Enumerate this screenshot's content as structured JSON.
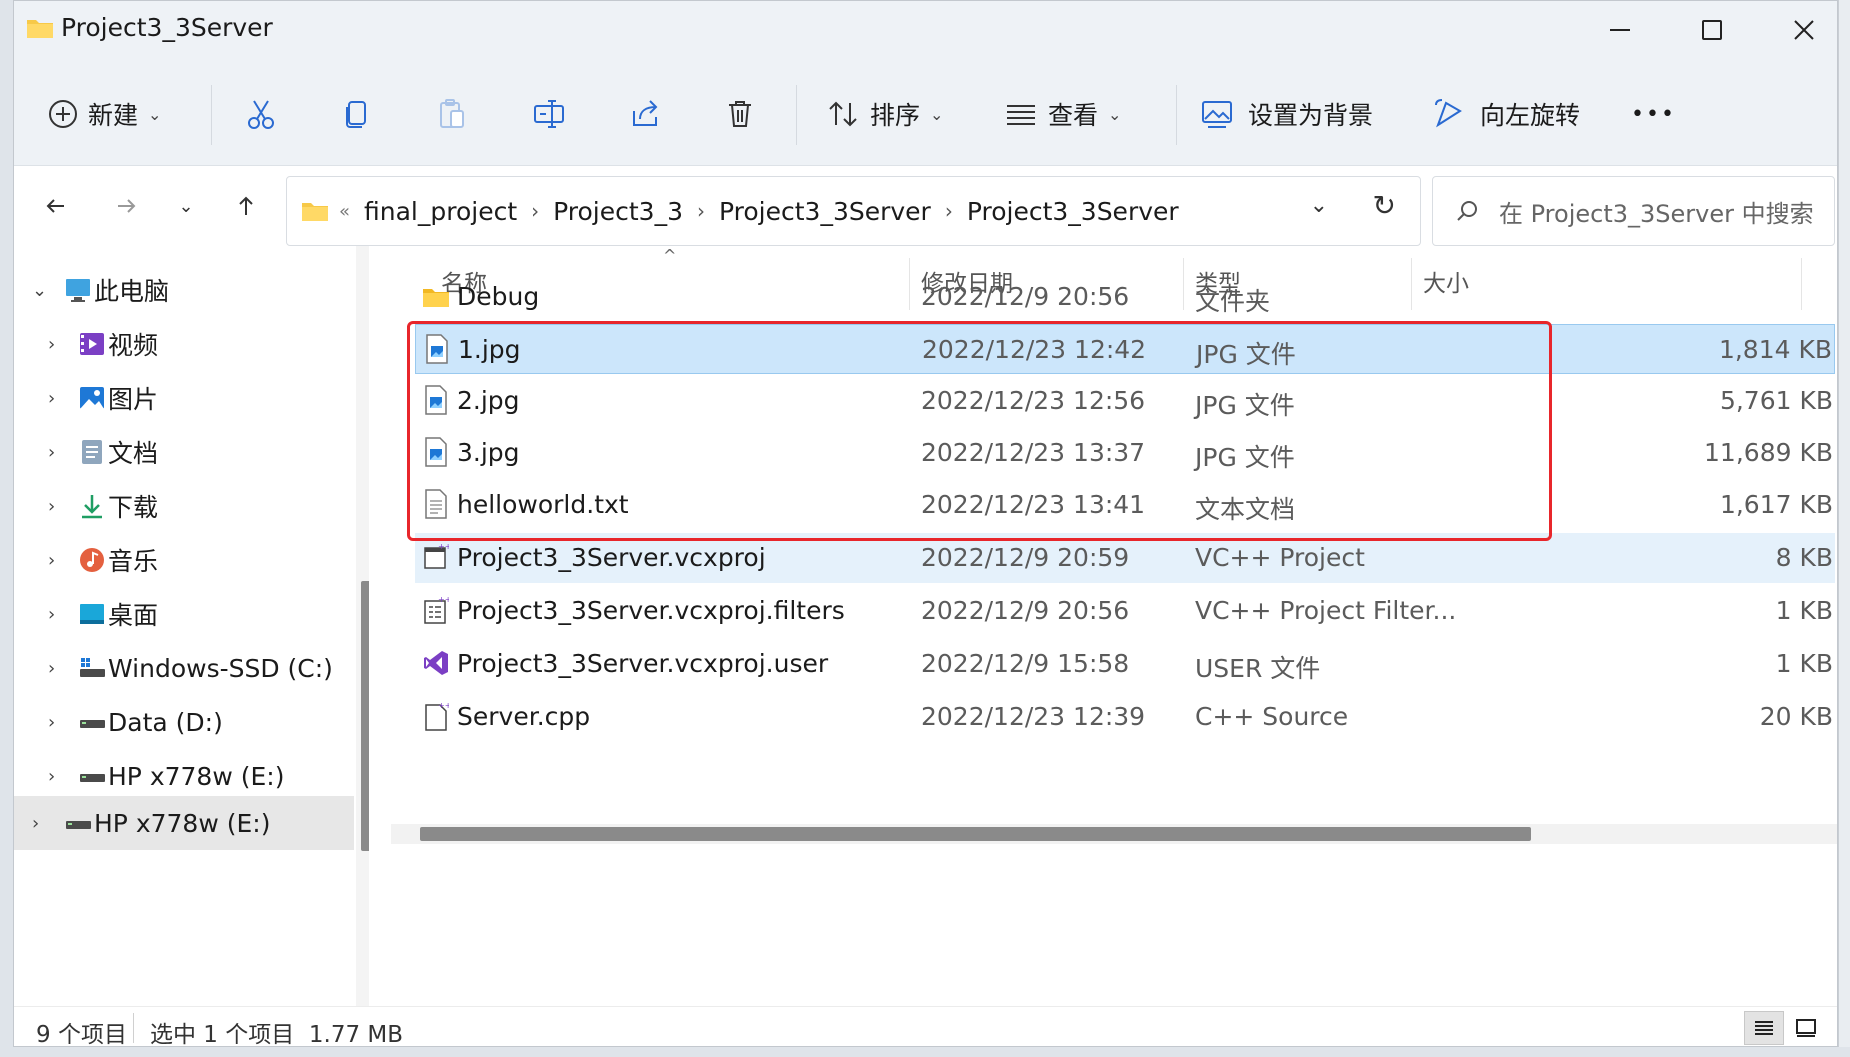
{
  "window": {
    "title": "Project3_3Server",
    "buttons": {
      "minimize": "—",
      "maximize": "□",
      "close": "✕"
    }
  },
  "toolbar": {
    "new_label": "新建",
    "sort_label": "排序",
    "view_label": "查看",
    "set_bg_label": "设置为背景",
    "rotate_label": "向左旋转",
    "more_label": "•••"
  },
  "address": {
    "overflow": "«",
    "crumbs": [
      "final_project",
      "Project3_3",
      "Project3_3Server",
      "Project3_3Server"
    ],
    "separator": "›"
  },
  "search": {
    "placeholder": "在 Project3_3Server 中搜索"
  },
  "sidebar": {
    "items": [
      {
        "label": "此电脑",
        "icon": "monitor-icon"
      },
      {
        "label": "视频",
        "icon": "video-icon"
      },
      {
        "label": "图片",
        "icon": "pictures-icon"
      },
      {
        "label": "文档",
        "icon": "documents-icon"
      },
      {
        "label": "下载",
        "icon": "download-icon"
      },
      {
        "label": "音乐",
        "icon": "music-icon"
      },
      {
        "label": "桌面",
        "icon": "desktop-icon"
      },
      {
        "label": "Windows-SSD (C:)",
        "icon": "drive-icon"
      },
      {
        "label": "Data (D:)",
        "icon": "drive-icon"
      },
      {
        "label": "HP x778w (E:)",
        "icon": "drive-icon"
      },
      {
        "label": "HP x778w (E:)",
        "icon": "drive-icon"
      }
    ]
  },
  "columns": {
    "name": "名称",
    "date": "修改日期",
    "type": "类型",
    "size": "大小",
    "sort_indicator": "^"
  },
  "files": [
    {
      "name": "Debug",
      "date": "2022/12/9 20:56",
      "type": "文件夹",
      "size": "",
      "icon": "folder-icon"
    },
    {
      "name": "1.jpg",
      "date": "2022/12/23 12:42",
      "type": "JPG 文件",
      "size": "1,814 KB",
      "icon": "image-file-icon"
    },
    {
      "name": "2.jpg",
      "date": "2022/12/23 12:56",
      "type": "JPG 文件",
      "size": "5,761 KB",
      "icon": "image-file-icon"
    },
    {
      "name": "3.jpg",
      "date": "2022/12/23 13:37",
      "type": "JPG 文件",
      "size": "11,689 KB",
      "icon": "image-file-icon"
    },
    {
      "name": "helloworld.txt",
      "date": "2022/12/23 13:41",
      "type": "文本文档",
      "size": "1,617 KB",
      "icon": "text-file-icon"
    },
    {
      "name": "Project3_3Server.vcxproj",
      "date": "2022/12/9 20:59",
      "type": "VC++ Project",
      "size": "8 KB",
      "icon": "vcxproj-icon"
    },
    {
      "name": "Project3_3Server.vcxproj.filters",
      "date": "2022/12/9 20:56",
      "type": "VC++ Project Filter...",
      "size": "1 KB",
      "icon": "filters-icon"
    },
    {
      "name": "Project3_3Server.vcxproj.user",
      "date": "2022/12/9 15:58",
      "type": "USER 文件",
      "size": "1 KB",
      "icon": "visual-studio-icon"
    },
    {
      "name": "Server.cpp",
      "date": "2022/12/23 12:39",
      "type": "C++ Source",
      "size": "20 KB",
      "icon": "cpp-file-icon"
    }
  ],
  "status": {
    "count": "9 个项目",
    "selection": "选中 1 个项目  1.77 MB"
  },
  "colors": {
    "selection": "#cce6fb",
    "highlight_box": "#e8262b",
    "toolbar_bg": "#eef2f6"
  }
}
